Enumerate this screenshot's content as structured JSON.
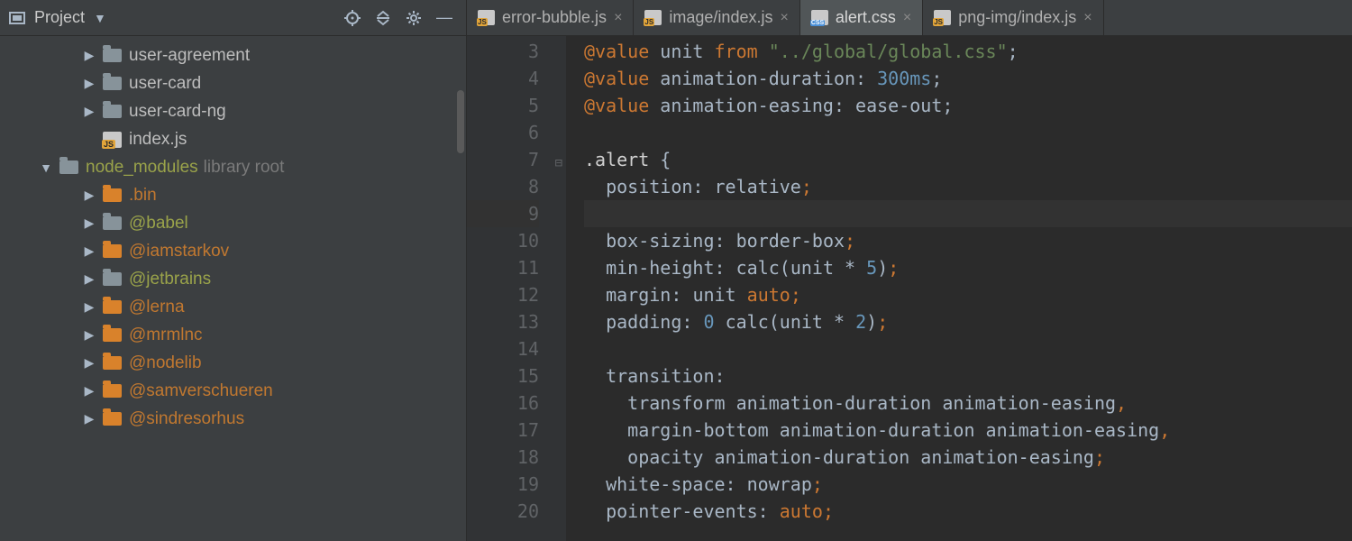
{
  "sidebar": {
    "title": "Project",
    "tree": [
      {
        "indent": 3,
        "tw": "col",
        "icon": "folder",
        "label": "user-agreement",
        "cls": "label"
      },
      {
        "indent": 3,
        "tw": "col",
        "icon": "folder",
        "label": "user-card",
        "cls": "label"
      },
      {
        "indent": 3,
        "tw": "col",
        "icon": "folder",
        "label": "user-card-ng",
        "cls": "label"
      },
      {
        "indent": 3,
        "tw": "",
        "icon": "js",
        "label": "index.js",
        "cls": "label"
      },
      {
        "indent": 1,
        "tw": "exp",
        "icon": "folder",
        "label": "node_modules",
        "cls": "node-lib",
        "hint": "library root"
      },
      {
        "indent": 3,
        "tw": "col",
        "icon": "folder-orange",
        "label": ".bin",
        "cls": "excl-label"
      },
      {
        "indent": 3,
        "tw": "col",
        "icon": "folder",
        "label": "@babel",
        "cls": "node-lib"
      },
      {
        "indent": 3,
        "tw": "col",
        "icon": "folder-orange",
        "label": "@iamstarkov",
        "cls": "excl-label"
      },
      {
        "indent": 3,
        "tw": "col",
        "icon": "folder",
        "label": "@jetbrains",
        "cls": "node-lib"
      },
      {
        "indent": 3,
        "tw": "col",
        "icon": "folder-orange",
        "label": "@lerna",
        "cls": "excl-label"
      },
      {
        "indent": 3,
        "tw": "col",
        "icon": "folder-orange",
        "label": "@mrmlnc",
        "cls": "excl-label"
      },
      {
        "indent": 3,
        "tw": "col",
        "icon": "folder-orange",
        "label": "@nodelib",
        "cls": "excl-label"
      },
      {
        "indent": 3,
        "tw": "col",
        "icon": "folder-orange",
        "label": "@samverschueren",
        "cls": "excl-label"
      },
      {
        "indent": 3,
        "tw": "col",
        "icon": "folder-orange",
        "label": "@sindresorhus",
        "cls": "excl-label"
      }
    ]
  },
  "tabs": [
    {
      "icon": "js",
      "label": "error-bubble.js",
      "active": false
    },
    {
      "icon": "js",
      "label": "image/index.js",
      "active": false
    },
    {
      "icon": "css",
      "label": "alert.css",
      "active": true
    },
    {
      "icon": "js",
      "label": "png-img/index.js",
      "active": false
    }
  ],
  "editor": {
    "first_line": 3,
    "current_line": 9,
    "lines": [
      {
        "n": 3,
        "seg": [
          [
            "t-at",
            "@value"
          ],
          [
            "",
            ""
          ],
          [
            "t-tv",
            " unit "
          ],
          [
            "t-kw",
            "from "
          ],
          [
            "t-str",
            "\"../global/global.css\""
          ],
          [
            "t-pg",
            ";"
          ]
        ]
      },
      {
        "n": 4,
        "seg": [
          [
            "t-at",
            "@value"
          ],
          [
            "t-tv",
            " animation-duration"
          ],
          [
            "t-pg",
            ": "
          ],
          [
            "t-num",
            "300ms"
          ],
          [
            "t-pg",
            ";"
          ]
        ]
      },
      {
        "n": 5,
        "seg": [
          [
            "t-at",
            "@value"
          ],
          [
            "t-tv",
            " animation-easing"
          ],
          [
            "t-pg",
            ": "
          ],
          [
            "t-tv",
            "ease-out"
          ],
          [
            "t-pg",
            ";"
          ]
        ]
      },
      {
        "n": 6,
        "seg": []
      },
      {
        "n": 7,
        "mark": "⊟",
        "seg": [
          [
            "t-sel",
            ".alert "
          ],
          [
            "t-pg",
            "{"
          ]
        ]
      },
      {
        "n": 8,
        "seg": [
          [
            "",
            "  "
          ],
          [
            "t-prop",
            "position"
          ],
          [
            "t-pg",
            ": "
          ],
          [
            "t-val",
            "relative"
          ],
          [
            "t-punc",
            ";"
          ]
        ]
      },
      {
        "n": 9,
        "seg": []
      },
      {
        "n": 10,
        "seg": [
          [
            "",
            "  "
          ],
          [
            "t-prop",
            "box-sizing"
          ],
          [
            "t-pg",
            ": "
          ],
          [
            "t-val",
            "border-box"
          ],
          [
            "t-punc",
            ";"
          ]
        ]
      },
      {
        "n": 11,
        "seg": [
          [
            "",
            "  "
          ],
          [
            "t-prop",
            "min-height"
          ],
          [
            "t-pg",
            ": "
          ],
          [
            "t-fn",
            "calc"
          ],
          [
            "t-pg",
            "("
          ],
          [
            "t-tv",
            "unit "
          ],
          [
            "t-pg",
            "* "
          ],
          [
            "t-num",
            "5"
          ],
          [
            "t-pg",
            ")"
          ],
          [
            "t-punc",
            ";"
          ]
        ]
      },
      {
        "n": 12,
        "seg": [
          [
            "",
            "  "
          ],
          [
            "t-prop",
            "margin"
          ],
          [
            "t-pg",
            ": "
          ],
          [
            "t-tv",
            "unit "
          ],
          [
            "t-const",
            "auto"
          ],
          [
            "t-punc",
            ";"
          ]
        ]
      },
      {
        "n": 13,
        "seg": [
          [
            "",
            "  "
          ],
          [
            "t-prop",
            "padding"
          ],
          [
            "t-pg",
            ": "
          ],
          [
            "t-num",
            "0 "
          ],
          [
            "t-fn",
            "calc"
          ],
          [
            "t-pg",
            "("
          ],
          [
            "t-tv",
            "unit "
          ],
          [
            "t-pg",
            "* "
          ],
          [
            "t-num",
            "2"
          ],
          [
            "t-pg",
            ")"
          ],
          [
            "t-punc",
            ";"
          ]
        ]
      },
      {
        "n": 14,
        "seg": []
      },
      {
        "n": 15,
        "seg": [
          [
            "",
            "  "
          ],
          [
            "t-prop",
            "transition"
          ],
          [
            "t-pg",
            ":"
          ]
        ]
      },
      {
        "n": 16,
        "seg": [
          [
            "",
            "    "
          ],
          [
            "t-val",
            "transform "
          ],
          [
            "t-tv",
            "animation-duration "
          ],
          [
            "t-tv",
            "animation-easing"
          ],
          [
            "t-punc",
            ","
          ]
        ]
      },
      {
        "n": 17,
        "seg": [
          [
            "",
            "    "
          ],
          [
            "t-val",
            "margin-bottom "
          ],
          [
            "t-tv",
            "animation-duration "
          ],
          [
            "t-tv",
            "animation-easing"
          ],
          [
            "t-punc",
            ","
          ]
        ]
      },
      {
        "n": 18,
        "seg": [
          [
            "",
            "    "
          ],
          [
            "t-val",
            "opacity "
          ],
          [
            "t-tv",
            "animation-duration "
          ],
          [
            "t-tv",
            "animation-easing"
          ],
          [
            "t-punc",
            ";"
          ]
        ]
      },
      {
        "n": 19,
        "seg": [
          [
            "",
            "  "
          ],
          [
            "t-prop",
            "white-space"
          ],
          [
            "t-pg",
            ": "
          ],
          [
            "t-val",
            "nowrap"
          ],
          [
            "t-punc",
            ";"
          ]
        ]
      },
      {
        "n": 20,
        "seg": [
          [
            "",
            "  "
          ],
          [
            "t-prop",
            "pointer-events"
          ],
          [
            "t-pg",
            ": "
          ],
          [
            "t-const",
            "auto"
          ],
          [
            "t-punc",
            ";"
          ]
        ]
      }
    ]
  }
}
